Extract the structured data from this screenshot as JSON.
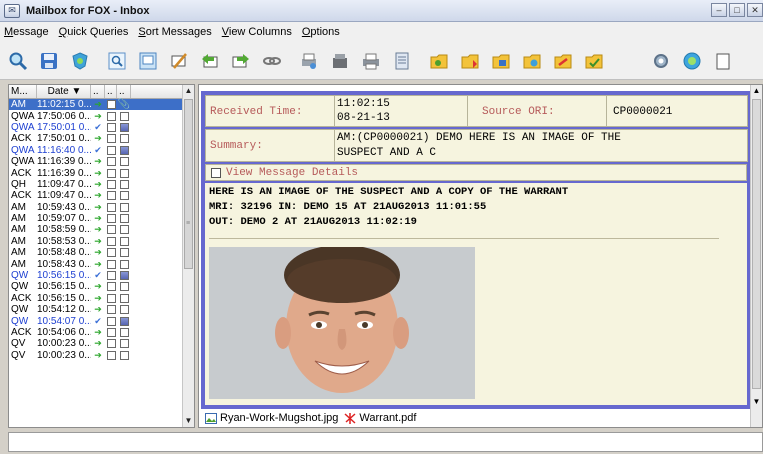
{
  "window": {
    "title": "Mailbox for FOX - Inbox"
  },
  "menu": [
    {
      "u": "M",
      "rest": "essage"
    },
    {
      "u": "Q",
      "rest": "uick Queries"
    },
    {
      "u": "S",
      "rest": "ort Messages"
    },
    {
      "u": "V",
      "rest": "iew Columns"
    },
    {
      "u": "O",
      "rest": "ptions"
    }
  ],
  "toolbar_icons": [
    "search-icon",
    "save-icon",
    "shield-icon",
    "find-icon",
    "view-icon",
    "compose-icon",
    "reply-icon",
    "forward-icon",
    "link-icon",
    "print-preview-icon",
    "archive-icon",
    "print-icon",
    "export-icon",
    "folder-a-icon",
    "folder-b-icon",
    "folder-c-icon",
    "folder-d-icon",
    "folder-e-icon",
    "folder-f-icon",
    "settings-icon",
    "help-icon"
  ],
  "list": {
    "headers": [
      "M...",
      "Date ▼",
      "..",
      "..",
      ".."
    ],
    "rows": [
      {
        "type": "AM",
        "date": "11:02:15 0...",
        "arrow": "green",
        "flag": "clip",
        "selected": true
      },
      {
        "type": "QWA",
        "date": "17:50:06 0...",
        "arrow": "green",
        "flag": "empty"
      },
      {
        "type": "QWA",
        "date": "17:50:01 0...",
        "arrow": "blue",
        "flag": "fill",
        "blue": true
      },
      {
        "type": "ACK",
        "date": "17:50:01 0...",
        "arrow": "green",
        "flag": "empty"
      },
      {
        "type": "QWA",
        "date": "11:16:40 0...",
        "arrow": "blue",
        "flag": "fill",
        "blue": true
      },
      {
        "type": "QWA",
        "date": "11:16:39 0...",
        "arrow": "green",
        "flag": "empty"
      },
      {
        "type": "ACK",
        "date": "11:16:39 0...",
        "arrow": "green",
        "flag": "empty"
      },
      {
        "type": "QH",
        "date": "11:09:47 0...",
        "arrow": "green",
        "flag": "empty"
      },
      {
        "type": "ACK",
        "date": "11:09:47 0...",
        "arrow": "green",
        "flag": "empty"
      },
      {
        "type": "AM",
        "date": "10:59:43 0...",
        "arrow": "green",
        "flag": "empty"
      },
      {
        "type": "AM",
        "date": "10:59:07 0...",
        "arrow": "green",
        "flag": "empty"
      },
      {
        "type": "AM",
        "date": "10:58:59 0...",
        "arrow": "green",
        "flag": "empty"
      },
      {
        "type": "AM",
        "date": "10:58:53 0...",
        "arrow": "green",
        "flag": "empty"
      },
      {
        "type": "AM",
        "date": "10:58:48 0...",
        "arrow": "green",
        "flag": "empty"
      },
      {
        "type": "AM",
        "date": "10:58:43 0...",
        "arrow": "green",
        "flag": "empty"
      },
      {
        "type": "QW",
        "date": "10:56:15 0...",
        "arrow": "blue",
        "flag": "fill",
        "blue": true
      },
      {
        "type": "QW",
        "date": "10:56:15 0...",
        "arrow": "green",
        "flag": "empty"
      },
      {
        "type": "ACK",
        "date": "10:56:15 0...",
        "arrow": "green",
        "flag": "empty"
      },
      {
        "type": "QW",
        "date": "10:54:12 0...",
        "arrow": "green",
        "flag": "empty"
      },
      {
        "type": "QW",
        "date": "10:54:07 0...",
        "arrow": "blue",
        "flag": "fill",
        "blue": true
      },
      {
        "type": "ACK",
        "date": "10:54:06 0...",
        "arrow": "green",
        "flag": "empty"
      },
      {
        "type": "QV",
        "date": "10:00:23 0...",
        "arrow": "green",
        "flag": "empty"
      },
      {
        "type": "QV",
        "date": "10:00:23 0...",
        "arrow": "green",
        "flag": "empty"
      }
    ]
  },
  "detail": {
    "received_label": "Received Time:",
    "received_line1": "11:02:15",
    "received_line2": "08-21-13",
    "source_label": "Source ORI:",
    "source_value": "CP0000021",
    "summary_label": "Summary:",
    "summary_line1": "AM:(CP0000021) DEMO HERE IS AN IMAGE OF THE",
    "summary_line2": "SUSPECT AND A C",
    "view_details_label": "View Message Details",
    "body_lines": [
      "HERE IS AN IMAGE OF THE SUSPECT AND A COPY OF THE WARRANT",
      "MRI: 32196 IN: DEMO 15 AT 21AUG2013 11:01:55",
      "OUT: DEMO 2 AT 21AUG2013 11:02:19"
    ],
    "attachments": [
      {
        "name": "Ryan-Work-Mugshot.jpg",
        "icon": "image-icon"
      },
      {
        "name": "Warrant.pdf",
        "icon": "pdf-icon"
      }
    ]
  },
  "colors": {
    "detail_frame": "#6668cf",
    "panel_bg": "#f6f4df",
    "label": "#b65a5a",
    "selected_row": "#3d6fc8",
    "priority_row_text": "#1d3fd1"
  }
}
